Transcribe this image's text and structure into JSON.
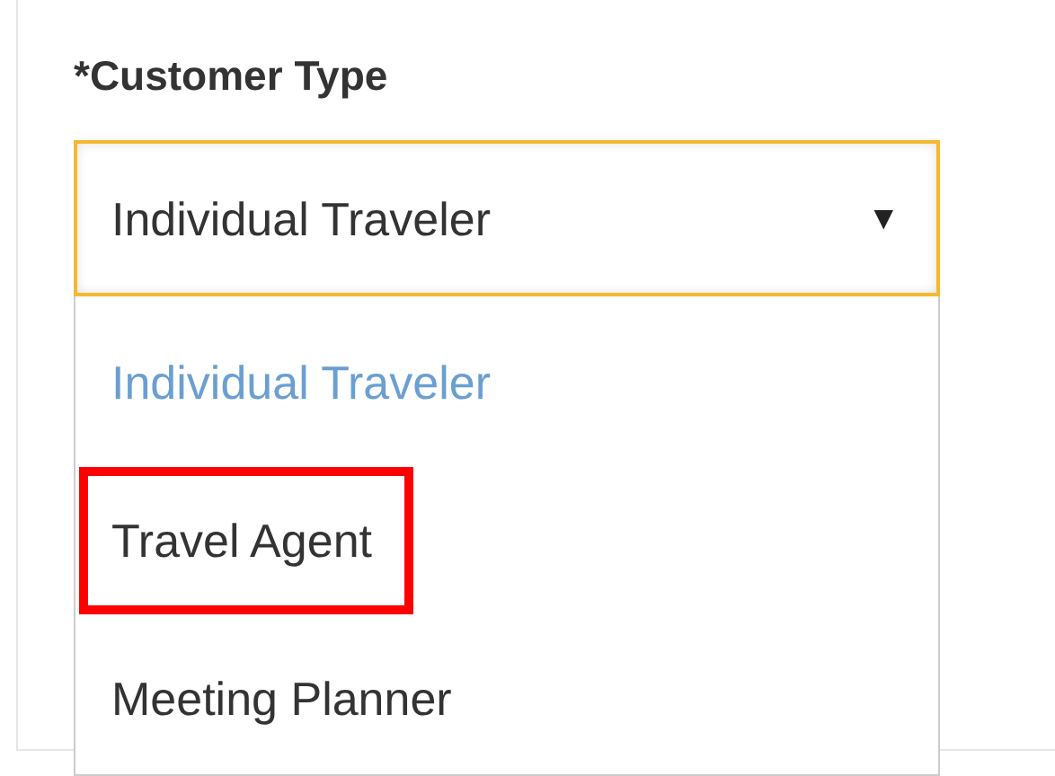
{
  "field": {
    "label": "*Customer Type",
    "value": "Individual Traveler",
    "caret": "▼",
    "focused": true
  },
  "dropdown": {
    "options": [
      {
        "label": "Individual Traveler",
        "selected": true,
        "highlighted": false
      },
      {
        "label": "Travel Agent",
        "selected": false,
        "highlighted": true
      },
      {
        "label": "Meeting Planner",
        "selected": false,
        "highlighted": false
      }
    ]
  }
}
